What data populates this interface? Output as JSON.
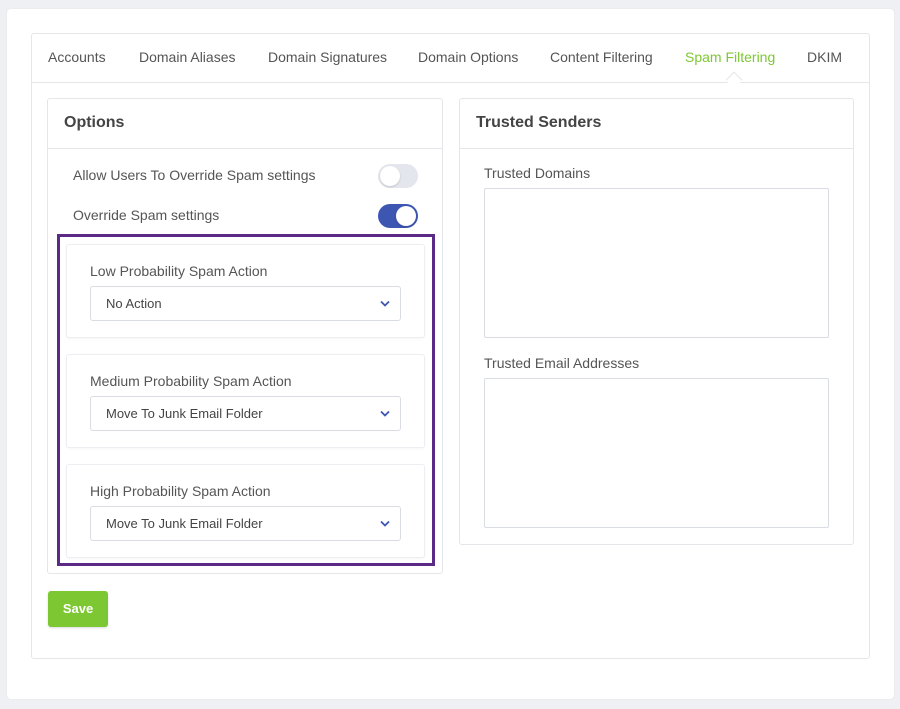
{
  "tabs": [
    {
      "label": "Accounts"
    },
    {
      "label": "Domain Aliases"
    },
    {
      "label": "Domain Signatures"
    },
    {
      "label": "Domain Options"
    },
    {
      "label": "Content Filtering"
    },
    {
      "label": "Spam Filtering",
      "active": true
    },
    {
      "label": "DKIM"
    }
  ],
  "options": {
    "title": "Options",
    "allow_override": {
      "label": "Allow Users To Override Spam settings",
      "enabled": false
    },
    "override_spam": {
      "label": "Override Spam settings",
      "enabled": true
    },
    "actions": [
      {
        "label": "Low Probability Spam Action",
        "value": "No Action"
      },
      {
        "label": "Medium Probability Spam Action",
        "value": "Move To Junk Email Folder"
      },
      {
        "label": "High Probability Spam Action",
        "value": "Move To Junk Email Folder"
      }
    ]
  },
  "trusted": {
    "title": "Trusted Senders",
    "domains_label": "Trusted Domains",
    "domains_value": "",
    "emails_label": "Trusted Email Addresses",
    "emails_value": ""
  },
  "save_label": "Save",
  "colors": {
    "accent_green": "#7dc832",
    "toggle_blue": "#3d56b2",
    "highlight_purple": "#5b2a86"
  }
}
